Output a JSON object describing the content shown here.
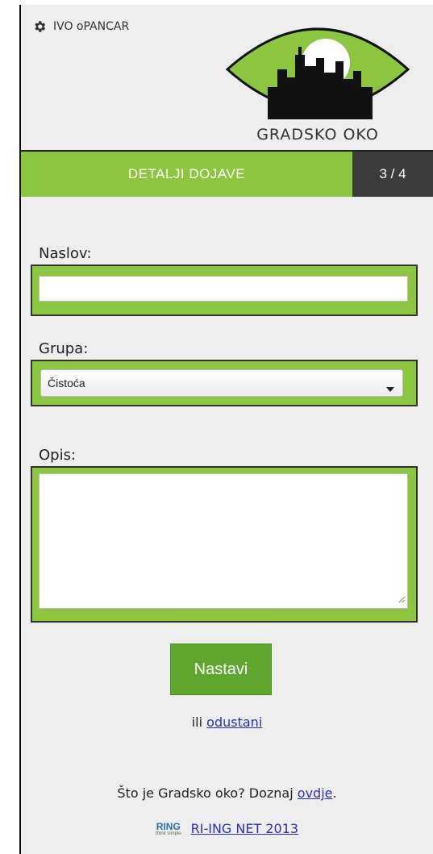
{
  "header": {
    "user_name": "IVO oPANCAR",
    "logo_text": "GRADSKO OKO"
  },
  "progress": {
    "title": "DETALJI DOJAVE",
    "step_label": "3 / 4"
  },
  "form": {
    "title_label": "Naslov:",
    "title_value": "",
    "group_label": "Grupa:",
    "group_selected": "Čistoća",
    "description_label": "Opis:",
    "description_value": "",
    "submit_label": "Nastavi"
  },
  "cancel": {
    "prefix": "ili",
    "link_text": "odustani"
  },
  "about": {
    "text": "Što je Gradsko oko? Doznaj",
    "link_text": "ovdje",
    "suffix": "."
  },
  "footer": {
    "logo_text": "RING",
    "logo_subtext": "think simple",
    "link_text": "RI-ING NET 2013"
  },
  "colors": {
    "accent_green": "#8cc63f",
    "button_green": "#5fa62e",
    "step_bg": "#3c3c3c",
    "link": "#2d2dcc"
  }
}
